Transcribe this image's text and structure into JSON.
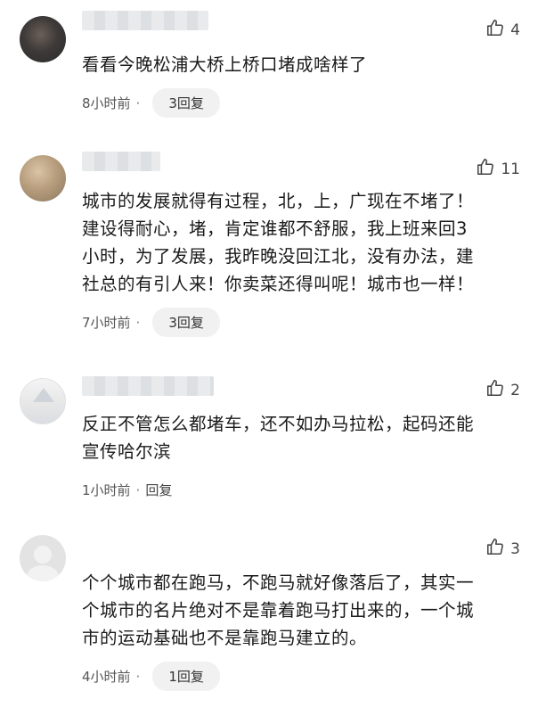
{
  "comments": [
    {
      "username": "",
      "likes": "4",
      "text": "看看今晚松浦大桥上桥口堵成啥样了",
      "time": "8小时前",
      "replies": "3回复"
    },
    {
      "username": "",
      "likes": "11",
      "text": "城市的发展就得有过程，北，上，广现在不堵了！\n建设得耐心，堵，肯定谁都不舒服，我上班来回3\n小时，为了发展，我昨晚没回江北，没有办法，建\n社总的有引人来！你卖菜还得叫呢！城市也一样！",
      "time": "7小时前",
      "replies": "3回复"
    },
    {
      "username": "",
      "likes": "2",
      "text": "反正不管怎么都堵车，还不如办马拉松，起码还能\n宣传哈尔滨",
      "time": "1小时前",
      "replies": "回复"
    },
    {
      "username": "",
      "likes": "3",
      "text": "个个城市都在跑马，不跑马就好像落后了，其实一\n个城市的名片绝对不是靠着跑马打出来的，一个城\n市的运动基础也不是靠跑马建立的。",
      "time": "4小时前",
      "replies": "1回复"
    }
  ],
  "separator": "·",
  "icons": {
    "like": "thumbs-up-icon"
  }
}
